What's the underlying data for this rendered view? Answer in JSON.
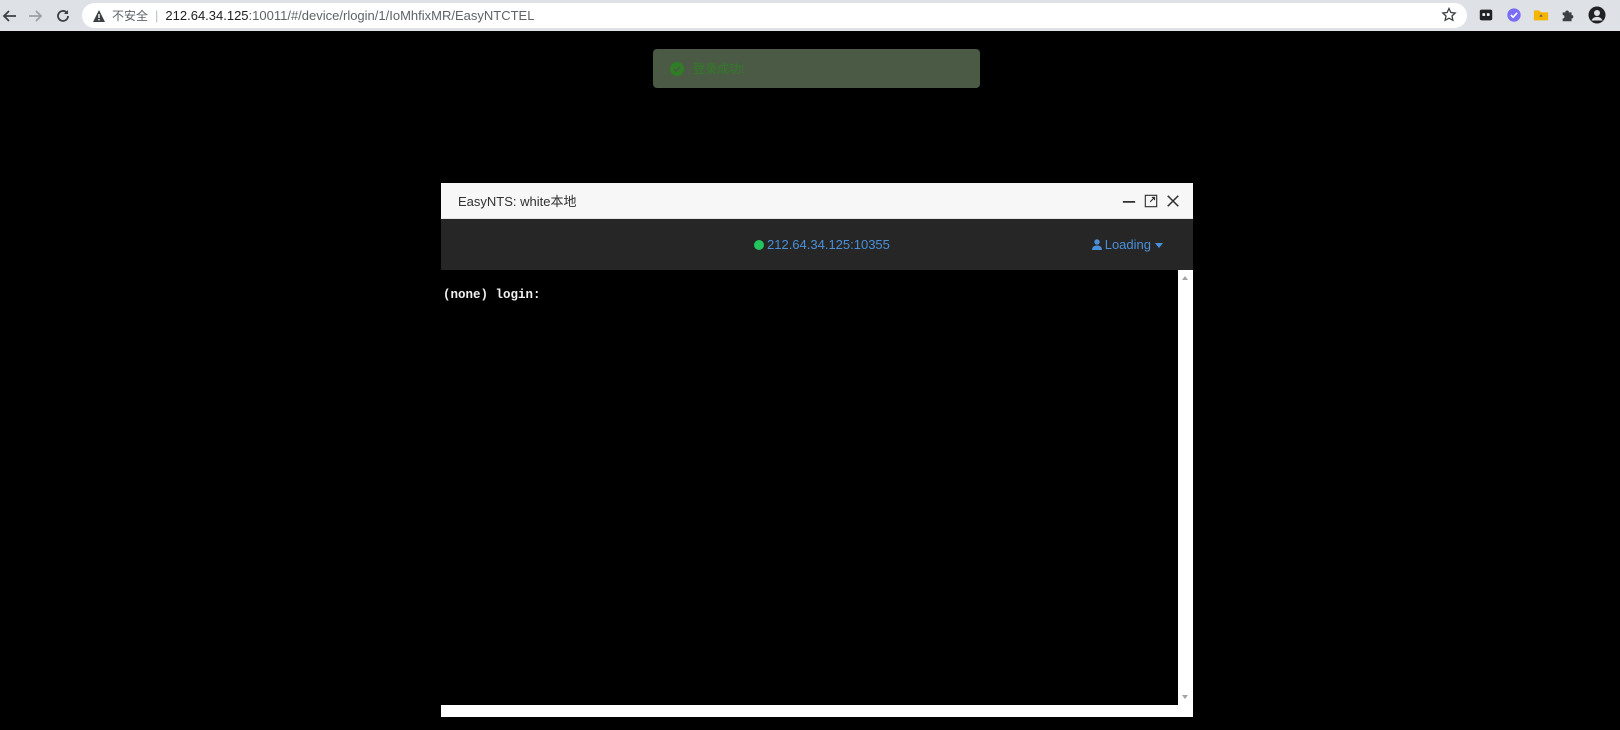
{
  "browser": {
    "insecure_label": "不安全",
    "url_host": "212.64.34.125",
    "url_path": ":10011/#/device/rlogin/1/IoMhfixMR/EasyNTCTEL"
  },
  "toast": {
    "message": "登录成功!"
  },
  "dialog": {
    "title": "EasyNTS: white本地",
    "status_address": "212.64.34.125:10355",
    "user_label": "Loading",
    "terminal_text": "(none) login:"
  },
  "colors": {
    "status_online": "#22c55e",
    "link_blue": "#4a90d9",
    "toast_green": "#2f7d24"
  }
}
